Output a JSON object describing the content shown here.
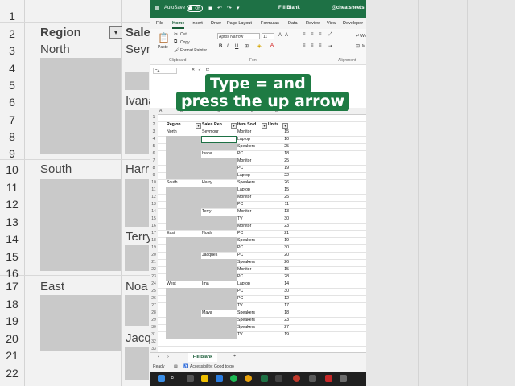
{
  "background": {
    "rows": [
      "1",
      "2",
      "3",
      "4",
      "5",
      "6",
      "7",
      "8",
      "9",
      "10",
      "11",
      "12",
      "13",
      "14",
      "15",
      "16",
      "17",
      "18",
      "19",
      "20",
      "21",
      "22"
    ],
    "header_region": "Region",
    "header_sales": "Sales",
    "north": "North",
    "south": "South",
    "east": "East",
    "sey": "Seyn",
    "ivana": "Ivana",
    "harry": "Harr",
    "terry": "Terry",
    "noah": "Noa",
    "jacq": "Jacq"
  },
  "titlebar": {
    "autosave": "AutoSave",
    "toggle": "Off",
    "file": "Fill Blank",
    "handle": "@cheatsheets"
  },
  "menu": [
    "File",
    "Home",
    "Insert",
    "Draw",
    "Page Layout",
    "Formulas",
    "Data",
    "Review",
    "View",
    "Developer"
  ],
  "ribbon": {
    "paste": "Paste",
    "cut": "Cut",
    "copy": "Copy",
    "format_painter": "Format Painter",
    "clipboard": "Clipboard",
    "font_name": "Aptos Narrow",
    "font_size": "11",
    "font_group": "Font",
    "alignment": "Alignment",
    "bold": "B",
    "italic": "I",
    "underline": "U",
    "wrap": "We",
    "merge": "M"
  },
  "formula_bar": {
    "name_box": "C4",
    "fx": "fx"
  },
  "banner": {
    "line1": "Type = and",
    "line2": "press the up arrow"
  },
  "columns": [
    "A",
    "B",
    "C",
    "D",
    "E"
  ],
  "table": {
    "headers": [
      "Region",
      "Sales Rep",
      "Item Sold",
      "Units"
    ],
    "rows": [
      [
        "",
        "",
        "",
        ""
      ],
      [
        "Region",
        "Sales Rep",
        "Item Sold",
        "Units"
      ],
      [
        "North",
        "Seymour",
        "Monitor",
        "15"
      ],
      [
        "",
        "",
        "Laptop",
        "10"
      ],
      [
        "",
        "",
        "Speakers",
        "25"
      ],
      [
        "",
        "Ivana",
        "PC",
        "18"
      ],
      [
        "",
        "",
        "Monitor",
        "25"
      ],
      [
        "",
        "",
        "PC",
        "19"
      ],
      [
        "",
        "",
        "Laptop",
        "22"
      ],
      [
        "South",
        "Harry",
        "Speakers",
        "26"
      ],
      [
        "",
        "",
        "Laptop",
        "15"
      ],
      [
        "",
        "",
        "Monitor",
        "25"
      ],
      [
        "",
        "",
        "PC",
        "11"
      ],
      [
        "",
        "Terry",
        "Monitor",
        "13"
      ],
      [
        "",
        "",
        "TV",
        "30"
      ],
      [
        "",
        "",
        "Monitor",
        "23"
      ],
      [
        "East",
        "Noah",
        "PC",
        "21"
      ],
      [
        "",
        "",
        "Speakers",
        "19"
      ],
      [
        "",
        "",
        "PC",
        "30"
      ],
      [
        "",
        "Jacques",
        "PC",
        "20"
      ],
      [
        "",
        "",
        "Speakers",
        "26"
      ],
      [
        "",
        "",
        "Monitor",
        "15"
      ],
      [
        "",
        "",
        "PC",
        "28"
      ],
      [
        "West",
        "Ima",
        "Laptop",
        "14"
      ],
      [
        "",
        "",
        "PC",
        "30"
      ],
      [
        "",
        "",
        "PC",
        "12"
      ],
      [
        "",
        "",
        "TV",
        "17"
      ],
      [
        "",
        "Maya",
        "Speakers",
        "18"
      ],
      [
        "",
        "",
        "Speakers",
        "23"
      ],
      [
        "",
        "",
        "Speakers",
        "27"
      ],
      [
        "",
        "",
        "TV",
        "19"
      ],
      [
        "",
        "",
        "",
        ""
      ],
      [
        "",
        "",
        "",
        ""
      ]
    ]
  },
  "sheetbar": {
    "tab": "Fill Blank",
    "add": "+"
  },
  "statusbar": {
    "ready": "Ready",
    "accessibility": "Accessibility: Good to go"
  }
}
